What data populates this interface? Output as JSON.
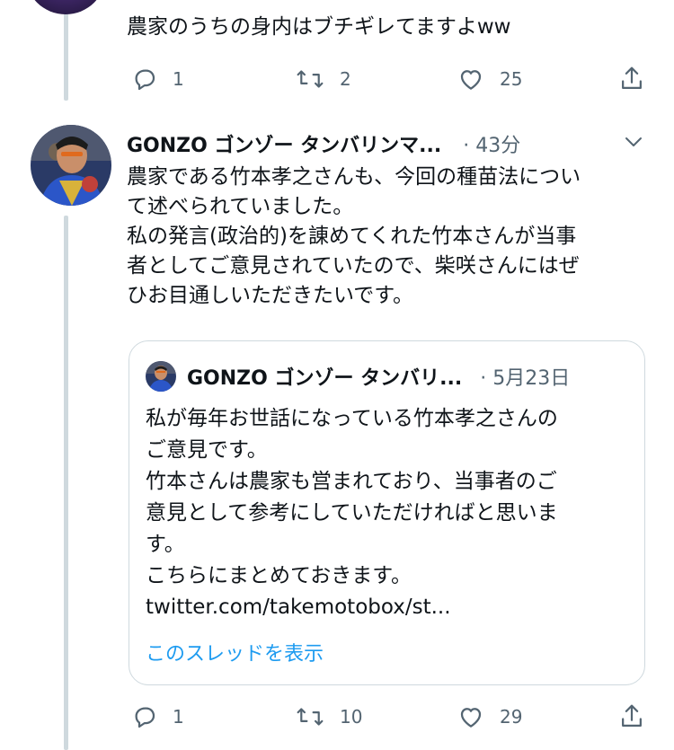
{
  "colors": {
    "accent": "#1d9bf0",
    "text": "#0f1419",
    "muted": "#536471",
    "thread_line": "#cfd9de"
  },
  "top_tweet": {
    "text": "農家のうちの身内はブチギレてますよww",
    "reply_count": "1",
    "retweet_count": "2",
    "like_count": "25"
  },
  "main_tweet": {
    "author_name": "GONZO ゴンゾー タンバリンマ...",
    "meta": "· 43分",
    "text": "農家である竹本孝之さんも、今回の種苗法につい\nて述べられていました。\n私の発言(政治的)を諌めてくれた竹本さんが当事\n者としてご意見されていたので、柴咲さんにはぜ\nひお目通しいただきたいです。",
    "reply_count": "1",
    "retweet_count": "10",
    "like_count": "29"
  },
  "quoted_tweet": {
    "author_name": "GONZO ゴンゾー タンバリ...",
    "meta": "· 5月23日",
    "text": "私が毎年お世話になっている竹本孝之さんの\nご意見です。\n竹本さんは農家も営まれており、当事者のご\n意見として参考にしていただければと思いま\nす。\nこちらにまとめておきます。\ntwitter.com/takemotobox/st...",
    "show_thread_label": "このスレッドを表示"
  },
  "icons": [
    "reply-icon",
    "retweet-icon",
    "like-icon",
    "share-icon",
    "chevron-down-icon"
  ]
}
